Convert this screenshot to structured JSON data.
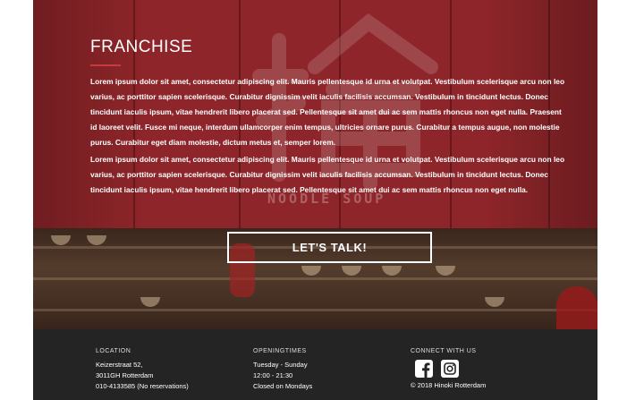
{
  "hero": {
    "title": "FRANCHISE",
    "paragraphs": [
      "Lorem ipsum dolor sit amet, consectetur adipiscing elit. Mauris pellentesque id urna et volutpat. Vestibulum scelerisque arcu non leo varius, ac porttitor sapien scelerisque. Curabitur dignissim velit iaculis facilisis accumsan. Vestibulum in tincidunt lectus. Donec tincidunt iaculis ipsum, vitae hendrerit libero placerat sed. Pellentesque sit amet dui ac sem mattis rhoncus non eget nulla. Praesent id laoreet velit. Fusce mi neque, interdum ullamcorper enim tempus, ultricies ornare purus. Curabitur a tempus augue, non molestie purus. Curabitur eget diam molestie, dictum metus et, semper lorem.",
      "Lorem ipsum dolor sit amet, consectetur adipiscing elit. Mauris pellentesque id urna et volutpat. Vestibulum scelerisque arcu non leo varius, ac porttitor sapien scelerisque. Curabitur dignissim velit iaculis facilisis accumsan. Vestibulum in tincidunt lectus. Donec tincidunt iaculis ipsum, vitae hendrerit libero placerat sed. Pellentesque sit amet dui ac sem mattis rhoncus non eget nulla."
    ],
    "cta_label": "LET'S TALK!",
    "watermark_text": "NOODLE SOUP",
    "colors": {
      "curtain": "#9c2b30",
      "accent": "#c73a40"
    }
  },
  "footer": {
    "location": {
      "heading": "LOCATION",
      "lines": [
        "Keizerstraat 52,",
        "3011GH Rotterdam",
        "010-4133585 (No reservations)"
      ]
    },
    "hours": {
      "heading": "OPENINGTIMES",
      "lines": [
        "Tuesday - Sunday",
        "12:00 - 21:30",
        "Closed on Mondays"
      ]
    },
    "connect": {
      "heading": "CONNECT WITH US",
      "icons": [
        "facebook-icon",
        "instagram-icon"
      ],
      "copyright": "© 2018 Hinoki Rotterdam"
    },
    "colors": {
      "background": "#242424"
    }
  }
}
